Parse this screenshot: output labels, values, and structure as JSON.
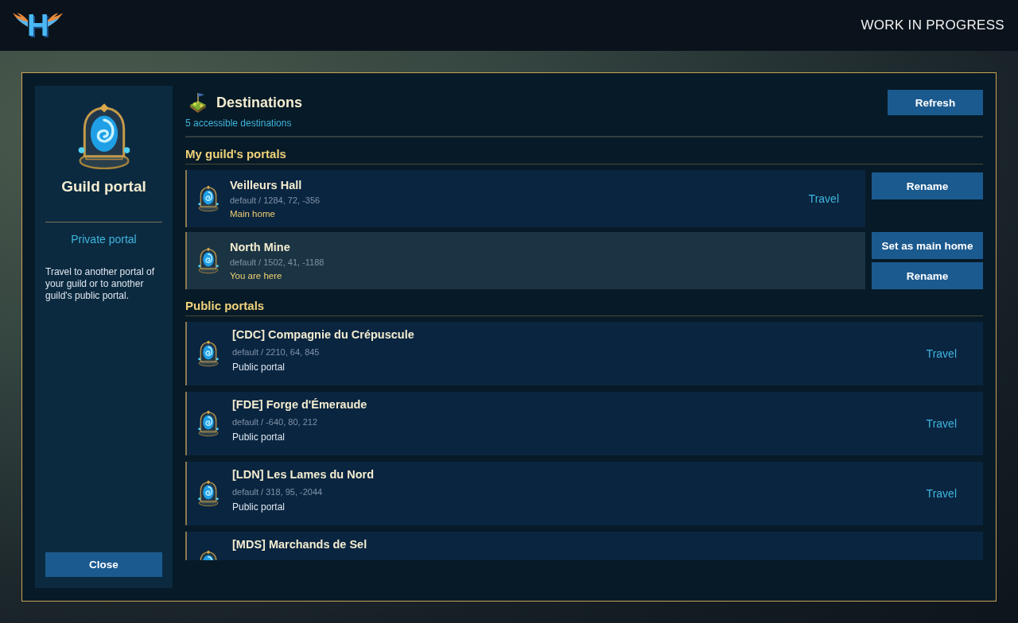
{
  "header": {
    "logo_letter": "H",
    "title": "WORK IN PROGRESS"
  },
  "sidebar": {
    "title": "Guild portal",
    "portal_type": "Private portal",
    "description": "Travel to another portal of your guild or to another guild's public portal.",
    "close_button": "Close"
  },
  "destinations": {
    "title": "Destinations",
    "subtitle": "5 accessible destinations",
    "refresh_button": "Refresh"
  },
  "sections": [
    {
      "kind": "guild",
      "title": "My guild's portals",
      "portals": [
        {
          "name": "Veilleurs Hall",
          "location": "default / 1284, 72, -356",
          "status": "Main home",
          "current": false,
          "travel": "Travel",
          "rename_button": "Rename"
        },
        {
          "name": "North Mine",
          "location": "default / 1502, 41, -1188",
          "status": "You are here",
          "current": true,
          "set_home_button": "Set as main home",
          "rename_button": "Rename"
        }
      ]
    },
    {
      "kind": "public",
      "title": "Public portals",
      "portals": [
        {
          "name": "[CDC] Compagnie du Crépuscule",
          "location": "default / 2210, 64, 845",
          "status": "Public portal",
          "current": false,
          "travel": "Travel"
        },
        {
          "name": "[FDE] Forge d'Émeraude",
          "location": "default / -640, 80, 212",
          "status": "Public portal",
          "current": false,
          "travel": "Travel"
        },
        {
          "name": "[LDN] Les Lames du Nord",
          "location": "default / 318, 95, -2044",
          "status": "Public portal",
          "current": false,
          "travel": "Travel"
        },
        {
          "name": "[MDS] Marchands de Sel",
          "current": false
        }
      ]
    }
  ]
}
